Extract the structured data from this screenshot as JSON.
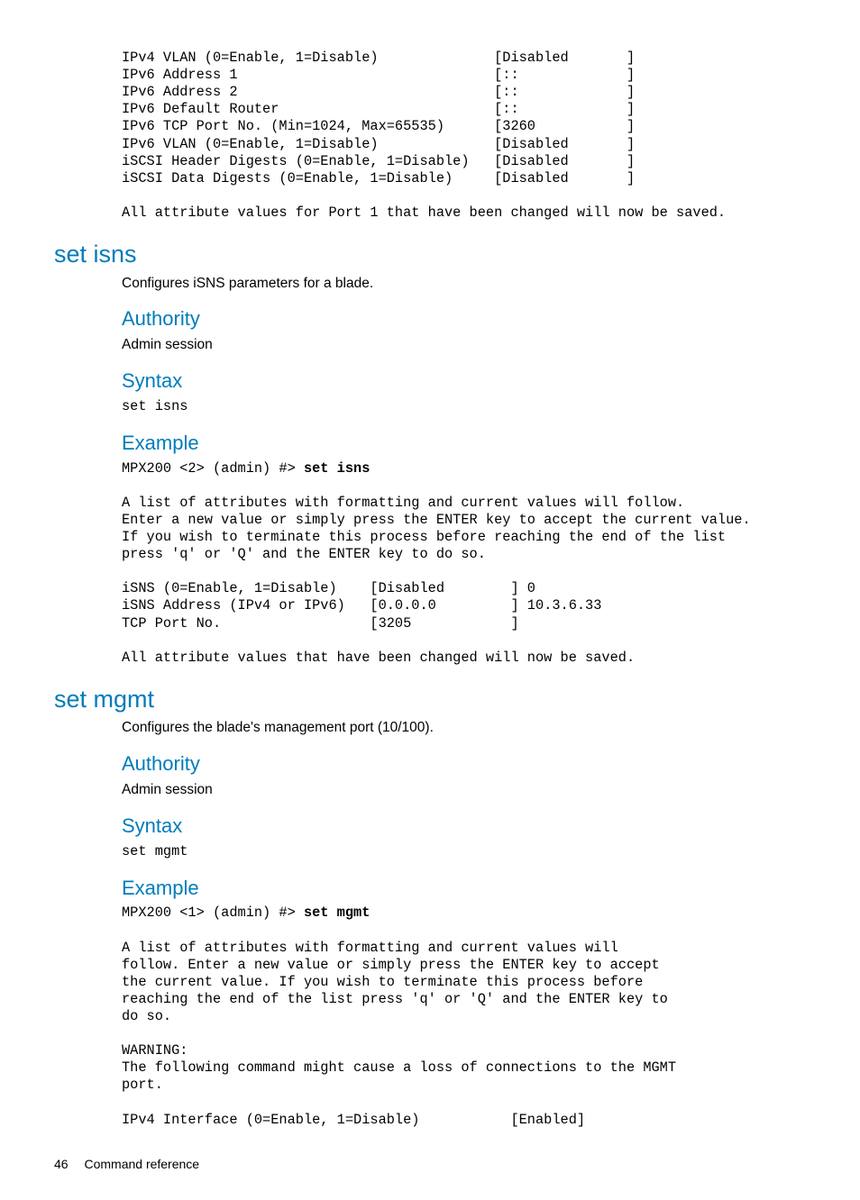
{
  "leadin_block": "IPv4 VLAN (0=Enable, 1=Disable)              [Disabled       ]\nIPv6 Address 1                               [::             ]\nIPv6 Address 2                               [::             ]\nIPv6 Default Router                          [::             ]\nIPv6 TCP Port No. (Min=1024, Max=65535)      [3260           ]\nIPv6 VLAN (0=Enable, 1=Disable)              [Disabled       ]\niSCSI Header Digests (0=Enable, 1=Disable)   [Disabled       ]\niSCSI Data Digests (0=Enable, 1=Disable)     [Disabled       ]\n\nAll attribute values for Port 1 that have been changed will now be saved.",
  "set_isns": {
    "heading": "set isns",
    "desc": "Configures iSNS parameters for a blade.",
    "authority_h": "Authority",
    "authority_b": "Admin session",
    "syntax_h": "Syntax",
    "syntax_b": "set isns",
    "example_h": "Example",
    "example_prompt": "MPX200 <2> (admin) #> ",
    "example_cmd": "set isns",
    "example_body": "A list of attributes with formatting and current values will follow.\nEnter a new value or simply press the ENTER key to accept the current value.\nIf you wish to terminate this process before reaching the end of the list\npress 'q' or 'Q' and the ENTER key to do so.\n\niSNS (0=Enable, 1=Disable)    [Disabled        ] 0\niSNS Address (IPv4 or IPv6)   [0.0.0.0         ] 10.3.6.33\nTCP Port No.                  [3205            ]\n\nAll attribute values that have been changed will now be saved."
  },
  "set_mgmt": {
    "heading": "set mgmt",
    "desc": "Configures the blade's management port (10/100).",
    "authority_h": "Authority",
    "authority_b": "Admin session",
    "syntax_h": "Syntax",
    "syntax_b": "set mgmt",
    "example_h": "Example",
    "example_prompt": "MPX200 <1> (admin) #> ",
    "example_cmd": "set mgmt",
    "example_body": "A list of attributes with formatting and current values will\nfollow. Enter a new value or simply press the ENTER key to accept\nthe current value. If you wish to terminate this process before\nreaching the end of the list press 'q' or 'Q' and the ENTER key to\ndo so.\n\nWARNING:\nThe following command might cause a loss of connections to the MGMT\nport.\n\nIPv4 Interface (0=Enable, 1=Disable)           [Enabled]"
  },
  "footer": {
    "page": "46",
    "section": "Command reference"
  }
}
